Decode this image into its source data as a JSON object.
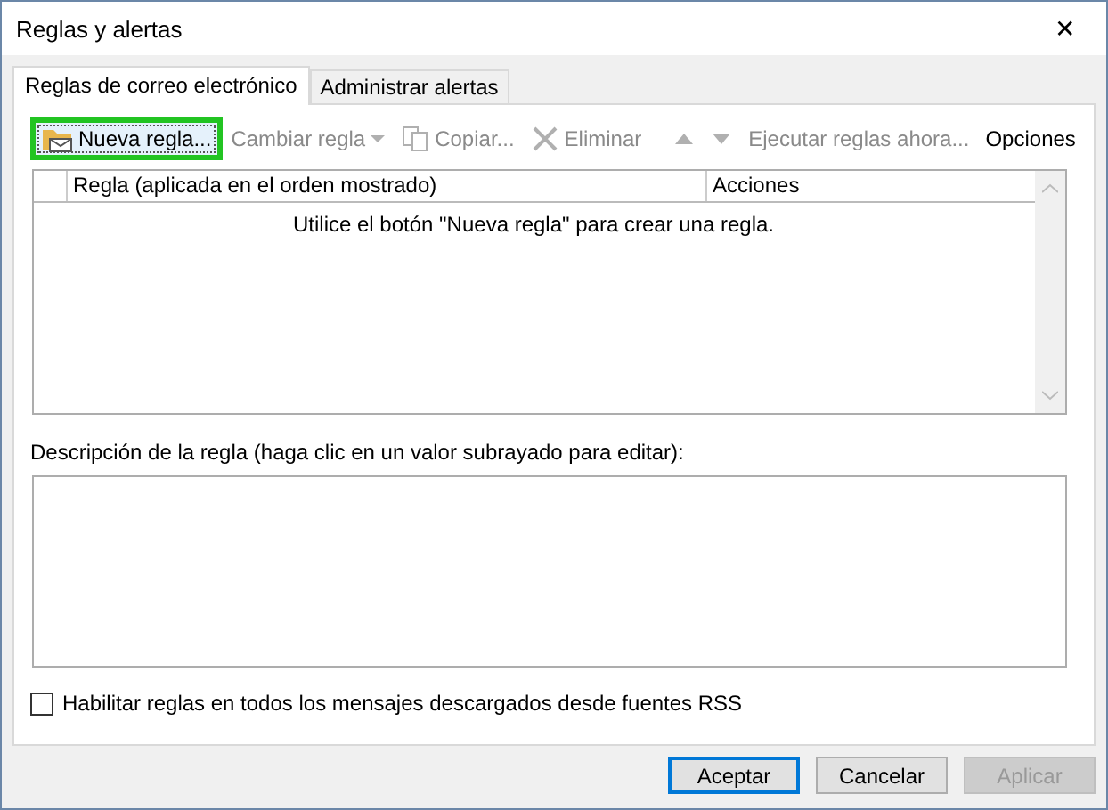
{
  "window": {
    "title": "Reglas y alertas",
    "close": "✕"
  },
  "tabs": [
    {
      "label": "Reglas de correo electrónico",
      "selected": true
    },
    {
      "label": "Administrar alertas",
      "selected": false
    }
  ],
  "toolbar": [
    {
      "kind": "new",
      "label": "Nueva regla...",
      "disabled": false,
      "selected": true
    },
    {
      "kind": "dropdown",
      "label": "Cambiar regla",
      "disabled": true,
      "selected": false
    },
    {
      "kind": "copy",
      "label": "Copiar...",
      "disabled": true,
      "selected": false
    },
    {
      "kind": "delete",
      "label": "Eliminar",
      "disabled": true,
      "selected": false
    },
    {
      "kind": "separator"
    },
    {
      "kind": "up",
      "disabled": true,
      "selected": false
    },
    {
      "kind": "down",
      "disabled": true,
      "selected": false
    },
    {
      "kind": "button",
      "label": "Ejecutar reglas ahora...",
      "disabled": true,
      "selected": false
    },
    {
      "kind": "button",
      "label": "Opciones",
      "disabled": false,
      "selected": false
    }
  ],
  "table": {
    "columns": [
      "Regla (aplicada en el orden mostrado)",
      "Acciones"
    ],
    "empty_message": "Utilice el botón \"Nueva regla\" para crear una regla."
  },
  "description": {
    "label": "Descripción de la regla (haga clic en un valor subrayado para editar):"
  },
  "rss_checkbox": {
    "label": "Habilitar reglas en todos los mensajes descargados desde fuentes RSS",
    "checked": false
  },
  "buttons": [
    {
      "label": "Aceptar",
      "default": true,
      "disabled": false
    },
    {
      "label": "Cancelar",
      "default": false,
      "disabled": false
    },
    {
      "label": "Aplicar",
      "default": false,
      "disabled": true
    }
  ]
}
